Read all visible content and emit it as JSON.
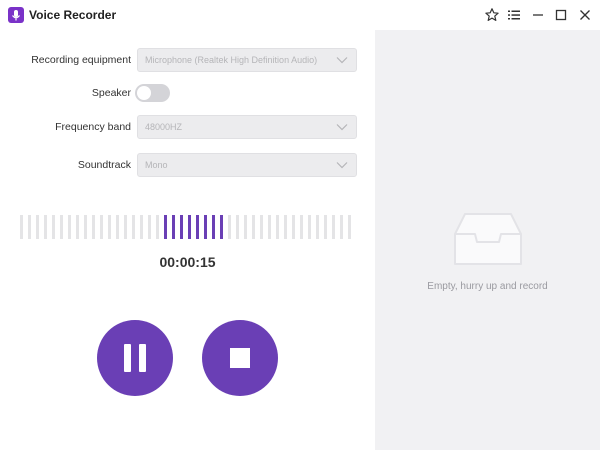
{
  "window": {
    "title": "Voice Recorder",
    "accent": "#6a3fb5",
    "icons": [
      "microphone-icon",
      "star-icon",
      "menu-list-icon",
      "minimize-icon",
      "maximize-icon",
      "close-icon"
    ]
  },
  "settings": {
    "recording_equipment": {
      "label": "Recording equipment",
      "value": "Microphone (Realtek High Definition Audio)"
    },
    "speaker": {
      "label": "Speaker",
      "enabled": false
    },
    "frequency_band": {
      "label": "Frequency band",
      "value": "48000HZ"
    },
    "soundtrack": {
      "label": "Soundtrack",
      "value": "Mono"
    }
  },
  "recorder": {
    "elapsed": "00:00:15",
    "controls": [
      "pause-icon",
      "stop-icon"
    ]
  },
  "history": {
    "empty_text": "Empty, hurry up and record",
    "icon": "empty-inbox-icon"
  }
}
